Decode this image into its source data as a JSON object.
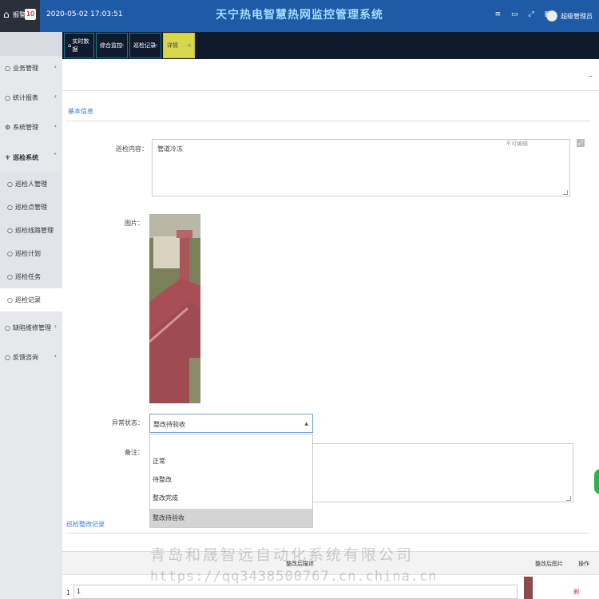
{
  "topbar": {
    "alarm_label": "报警",
    "alarm_count": "10",
    "datetime": "2020-05-02 17:03:51",
    "app_title": "天宁热电智慧热网监控管理系统",
    "user_name": "超级管理员"
  },
  "sidebar": {
    "items": [
      {
        "label": "业务管理"
      },
      {
        "label": "统计报表"
      },
      {
        "label": "系统管理"
      },
      {
        "label": "巡检系统"
      },
      {
        "label": "缺陷维修管理"
      },
      {
        "label": "反馈咨询"
      }
    ],
    "sub_items": [
      {
        "label": "巡检人管理"
      },
      {
        "label": "巡检点管理"
      },
      {
        "label": "巡检线路管理"
      },
      {
        "label": "巡检计划"
      },
      {
        "label": "巡检任务"
      },
      {
        "label": "巡检记录"
      }
    ]
  },
  "tabs": [
    {
      "label": "实时数据"
    },
    {
      "label": "综合监控"
    },
    {
      "label": "巡检记录"
    },
    {
      "label": "详情"
    }
  ],
  "form": {
    "section_basic": "基本信息",
    "content_label": "巡检内容：",
    "content_value": "管道冷冻",
    "ghost_btn": "不可编辑",
    "image_label": "图片：",
    "status_label": "异常状态：",
    "status_value": "整改待验收",
    "status_options": [
      "正常",
      "待整改",
      "整改完成",
      "整改待验收"
    ],
    "remark_label": "备注："
  },
  "records": {
    "section_title": "巡检整改记录",
    "columns": {
      "desc": "整改后描述",
      "image": "整改后图片",
      "action": "操作"
    },
    "rows": [
      {
        "index": "1",
        "desc": "1",
        "action": "删"
      }
    ]
  },
  "watermark": {
    "company": "青岛和晟智远自动化系统有限公司",
    "url": "https://qq3438500767.cn.china.cn"
  },
  "colors": {
    "topbar": "#1e5aa6",
    "tab_active": "#d8d64c",
    "accent": "#3a7bd5"
  }
}
